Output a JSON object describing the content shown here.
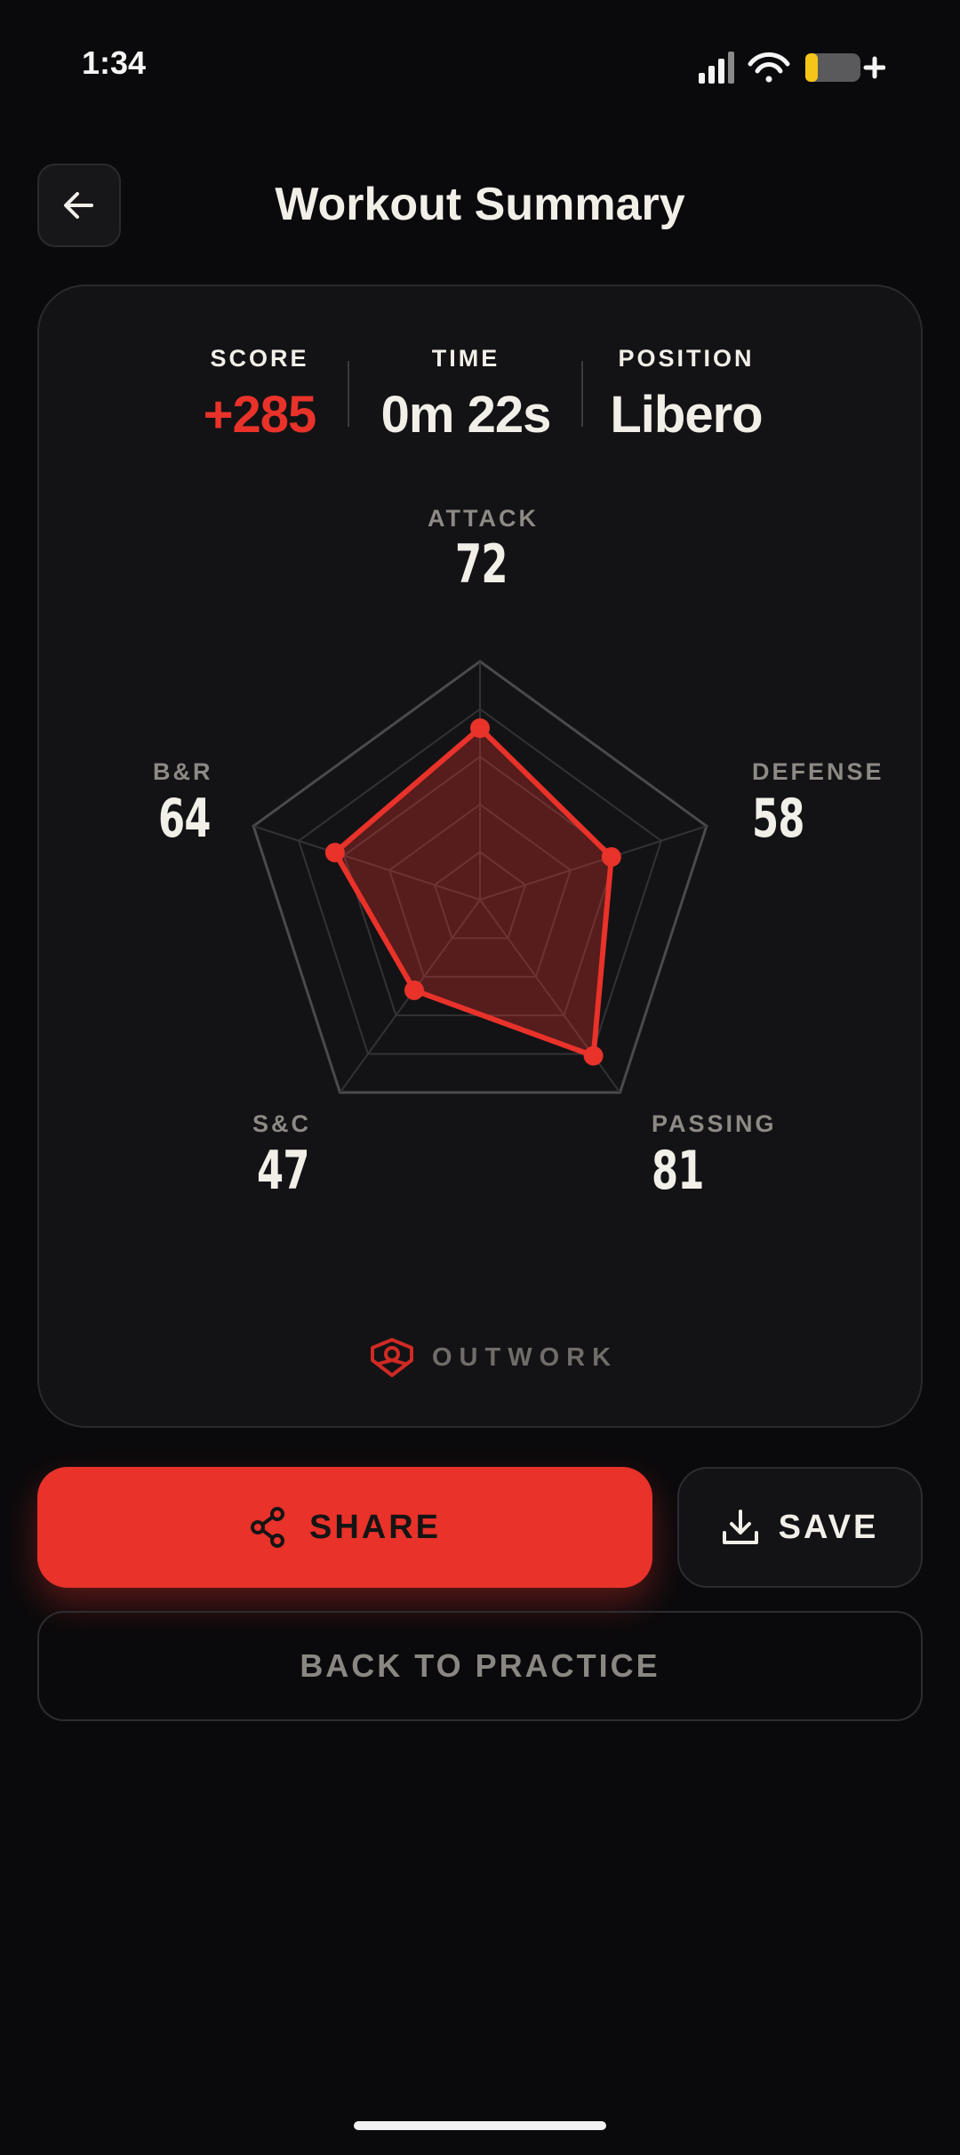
{
  "status_bar": {
    "time": "1:34",
    "icons": [
      "signal-icon",
      "wifi-icon",
      "battery-charging-icon"
    ]
  },
  "header": {
    "back_icon": "arrow-left-icon",
    "title": "Workout Summary"
  },
  "summary": {
    "score": {
      "label": "SCORE",
      "value": "+285"
    },
    "time": {
      "label": "TIME",
      "value": "0m 22s"
    },
    "position": {
      "label": "POSITION",
      "value": "Libero"
    }
  },
  "radar": {
    "scale_max": 100,
    "rings": 5,
    "axes": [
      {
        "label": "ATTACK",
        "value": 72
      },
      {
        "label": "DEFENSE",
        "value": 58
      },
      {
        "label": "PASSING",
        "value": 81
      },
      {
        "label": "S&C",
        "value": 47
      },
      {
        "label": "B&R",
        "value": 64
      }
    ]
  },
  "brand": {
    "name": "OUTWORK",
    "icon": "outwork-logo-icon"
  },
  "actions": {
    "share_label": "SHARE",
    "share_icon": "share-icon",
    "save_label": "SAVE",
    "save_icon": "download-icon",
    "back_to_practice_label": "BACK TO PRACTICE"
  },
  "colors": {
    "accent": "#e8322a",
    "background": "#0a0a0c",
    "card": "#131315",
    "battery": "#f5c518"
  }
}
